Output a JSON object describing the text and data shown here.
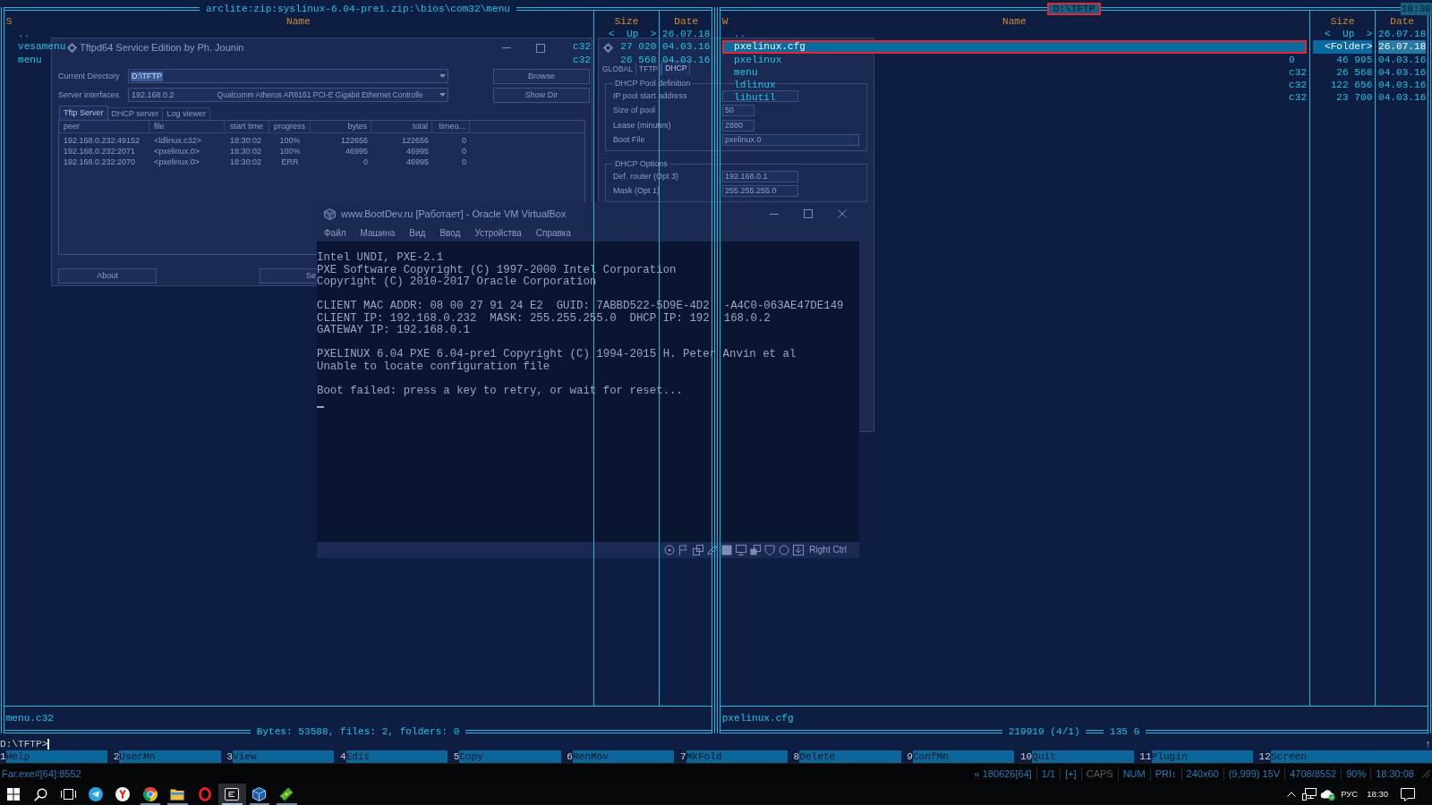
{
  "desktop": {
    "tftpd_window": {
      "title": "Tftpd64 Service Edition by Ph. Jounin",
      "current_directory_label": "Current Directory",
      "current_directory": "D:\\TFTP",
      "server_interfaces_label": "Server interfaces",
      "server_ip": "192.168.0.2",
      "server_adapter": "Qualcomm Atheros AR8161 PCI-E Gigabit Ethernet Controlle",
      "side_buttons": [
        "Browse",
        "Show Dir"
      ],
      "tabs": [
        {
          "label": "Tftp Server",
          "selected": true
        },
        {
          "label": "DHCP server",
          "selected": false
        },
        {
          "label": "Log viewer",
          "selected": false
        }
      ],
      "table": {
        "columns": [
          "peer",
          "file",
          "start time",
          "progress",
          "bytes",
          "total",
          "timeo..."
        ],
        "rows": [
          [
            "192.168.0.232:49152",
            "<ldlinux.c32>",
            "18:30:02",
            "100%",
            "122656",
            "122656",
            "0"
          ],
          [
            "192.168.0.232:2071",
            "<pxelinux.0>",
            "18:30:02",
            "100%",
            "46995",
            "46995",
            "0"
          ],
          [
            "192.168.0.232:2070",
            "<pxelinux.0>",
            "18:30:02",
            "ERR",
            "0",
            "46995",
            "0"
          ]
        ]
      },
      "bottom_buttons": [
        "About",
        "Se"
      ]
    },
    "settings_window": {
      "tabs": [
        {
          "label": "GLOBAL",
          "selected": false
        },
        {
          "label": "TFTP",
          "selected": false
        },
        {
          "label": "DHCP",
          "selected": true
        }
      ],
      "groups": [
        {
          "title": "DHCP Pool definition",
          "fields": [
            {
              "label": "IP pool start address",
              "kind": "medium"
            },
            {
              "label": "Size of pool",
              "value": "50",
              "kind": "short"
            },
            {
              "label": "Lease (minutes)",
              "value": "2880",
              "kind": "short"
            },
            {
              "label": "Boot File",
              "value": "pxelinux.0",
              "kind": "wide"
            }
          ]
        },
        {
          "title": "DHCP Options",
          "fields": [
            {
              "label": "Def. router (Opt 3)",
              "value": "192.168.0.1",
              "kind": "medium"
            },
            {
              "label": "Mask (Opt 1)",
              "value": "255.255.255.0",
              "kind": "medium"
            }
          ]
        }
      ]
    },
    "virtualbox_window": {
      "title": "www.BootDev.ru [Работает] - Oracle VM VirtualBox",
      "menu": [
        "Файл",
        "Машина",
        "Вид",
        "Ввод",
        "Устройства",
        "Справка"
      ],
      "screen_paragraphs": [
        [
          "Intel UNDI, PXE-2.1",
          "PXE Software Copyright (C) 1997-2000 Intel Corporation",
          "Copyright (C) 2010-2017 Oracle Corporation"
        ],
        [
          [
            "CLIENT MAC ADDR: 08 00 27 91 24 E2  GUID: 7ABBD522-5D9E-4D2",
            "-A4C0-063AE47DE149"
          ],
          [
            "CLIENT IP: 192.168.0.232  MASK: 255.255.255.0  DHCP IP: 192",
            "168.0.2"
          ],
          "GATEWAY IP: 192.168.0.1"
        ],
        [
          "PXELINUX 6.04 PXE 6.04-pre1 Copyright (C) 1994-2015 H. Peter Anvin et al",
          "Unable to locate configuration file"
        ],
        [
          "Boot failed: press a key to retry, or wait for reset..."
        ]
      ],
      "host_key": "Right Ctrl"
    }
  },
  "left_panel": {
    "title": "arclite:zip:syslinux-6.04-pre1.zip:\\bios\\com32\\menu",
    "active": false,
    "sort_indicator": "S",
    "columns": [
      "Name",
      "Size",
      "Date"
    ],
    "files": [
      {
        "name": "..",
        "size": "<  Up  >",
        "date": "26.07.18",
        "selected": false
      },
      {
        "name": "vesamenu",
        "ext": "c32",
        "size": "27 020",
        "date": "04.03.16",
        "selected": false
      },
      {
        "name": "menu",
        "ext": "c32",
        "size": "26 568",
        "date": "04.03.16",
        "selected": false
      }
    ],
    "current_file": "menu.c32",
    "totals": [
      "Bytes: 53588, files: 2, folders: 0"
    ]
  },
  "right_panel": {
    "title": "D:\\TFTP",
    "active": true,
    "title_annotated": true,
    "sort_indicator": "W",
    "columns": [
      "Name",
      "Size",
      "Date"
    ],
    "files": [
      {
        "name": "..",
        "size": "<  Up  >",
        "date": "26.07.18",
        "selected": false,
        "annotated": false
      },
      {
        "name": "pxelinux.cfg",
        "size": "<Folder>",
        "date": "26.07.18",
        "selected": true,
        "annotated": true
      },
      {
        "name": "pxelinux",
        "ext": "0",
        "size": "46 995",
        "date": "04.03.16",
        "selected": false,
        "annotated": false
      },
      {
        "name": "menu",
        "ext": "c32",
        "size": "26 568",
        "date": "04.03.16",
        "selected": false,
        "annotated": false
      },
      {
        "name": "ldlinux",
        "ext": "c32",
        "size": "122 656",
        "date": "04.03.16",
        "selected": false,
        "annotated": false
      },
      {
        "name": "libutil",
        "ext": "c32",
        "size": "23 700",
        "date": "04.03.16",
        "selected": false,
        "annotated": false
      }
    ],
    "current_file": "pxelinux.cfg",
    "totals": [
      "219919 (4/1)",
      "135 G"
    ]
  },
  "clock": "18:30",
  "command_line": {
    "prompt": "D:\\TFTP>",
    "scroll_indicator": "↑"
  },
  "keybar": [
    {
      "key": "1",
      "label": "Help"
    },
    {
      "key": "2",
      "label": "UserMn"
    },
    {
      "key": "3",
      "label": "View"
    },
    {
      "key": "4",
      "label": "Edit"
    },
    {
      "key": "5",
      "label": "Copy"
    },
    {
      "key": "6",
      "label": "RenMov"
    },
    {
      "key": "7",
      "label": "MkFold"
    },
    {
      "key": "8",
      "label": "Delete"
    },
    {
      "key": "9",
      "label": "ConfMn"
    },
    {
      "key": "10",
      "label": "Quit"
    },
    {
      "key": "11",
      "label": "Plugin"
    },
    {
      "key": "12",
      "label": "Screen"
    }
  ],
  "status_bar": {
    "process": "Far.exe#[64]:8552",
    "items": [
      {
        "text": "« 180626[64]",
        "enabled": true
      },
      {
        "text": "1/1",
        "enabled": true
      },
      {
        "text": "[+]",
        "enabled": true
      },
      {
        "text": "CAPS",
        "enabled": false
      },
      {
        "text": "NUM",
        "enabled": true
      },
      {
        "text": "PRI↕",
        "enabled": true
      },
      {
        "text": "240x60",
        "enabled": true
      },
      {
        "text": "(9,999) 15V",
        "enabled": true
      },
      {
        "text": "4708/8552",
        "enabled": true
      },
      {
        "text": "90%",
        "enabled": true
      },
      {
        "text": "18:30:08",
        "enabled": true
      }
    ]
  },
  "taskbar": {
    "apps": [
      {
        "kind": "paper-plane",
        "running": false,
        "active": false
      },
      {
        "kind": "fork-logo",
        "running": false,
        "active": false
      },
      {
        "kind": "tricolor-ball",
        "running": true,
        "active": false
      },
      {
        "kind": "folder",
        "running": true,
        "active": false
      },
      {
        "kind": "ring",
        "running": false,
        "active": false
      },
      {
        "kind": "console",
        "running": true,
        "active": true
      },
      {
        "kind": "cube",
        "running": true,
        "active": false
      },
      {
        "kind": "banknote",
        "running": true,
        "active": false
      }
    ],
    "tray": {
      "language": "РУС",
      "time": "18:30"
    }
  }
}
